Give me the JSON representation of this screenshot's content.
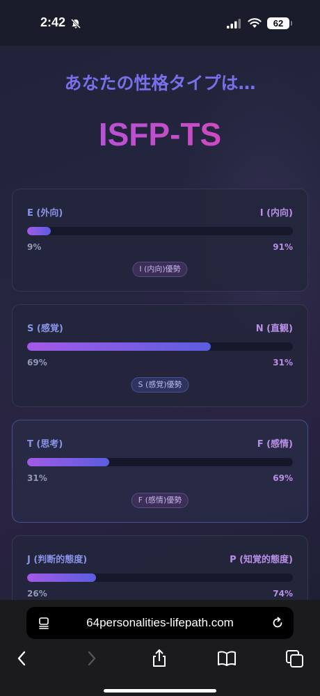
{
  "status_bar": {
    "time": "2:42",
    "battery": "62"
  },
  "page": {
    "subtitle": "あなたの性格タイプは…",
    "type_code": "ISFP-TS"
  },
  "dimensions": [
    {
      "left_label": "E (外向)",
      "right_label": "I (内向)",
      "left_pct": "9%",
      "right_pct": "91%",
      "fill_fraction": 0.09,
      "badge": "I (内向)優勢",
      "badge_style": "purple"
    },
    {
      "left_label": "S (感覚)",
      "right_label": "N (直観)",
      "left_pct": "69%",
      "right_pct": "31%",
      "fill_fraction": 0.69,
      "badge": "S (感覚)優勢",
      "badge_style": "blue"
    },
    {
      "left_label": "T (思考)",
      "right_label": "F (感情)",
      "left_pct": "31%",
      "right_pct": "69%",
      "fill_fraction": 0.31,
      "badge": "F (感情)優勢",
      "badge_style": "purple"
    },
    {
      "left_label": "J (判断的態度)",
      "right_label": "P (知覚的態度)",
      "left_pct": "26%",
      "right_pct": "74%",
      "fill_fraction": 0.26,
      "badge": "",
      "badge_style": "purple"
    }
  ],
  "browser": {
    "url": "64personalities-lifepath.com"
  },
  "colors": {
    "accent_purple": "#a35ae6",
    "accent_blue": "#5b5de0",
    "title_pink": "#e243b0"
  }
}
